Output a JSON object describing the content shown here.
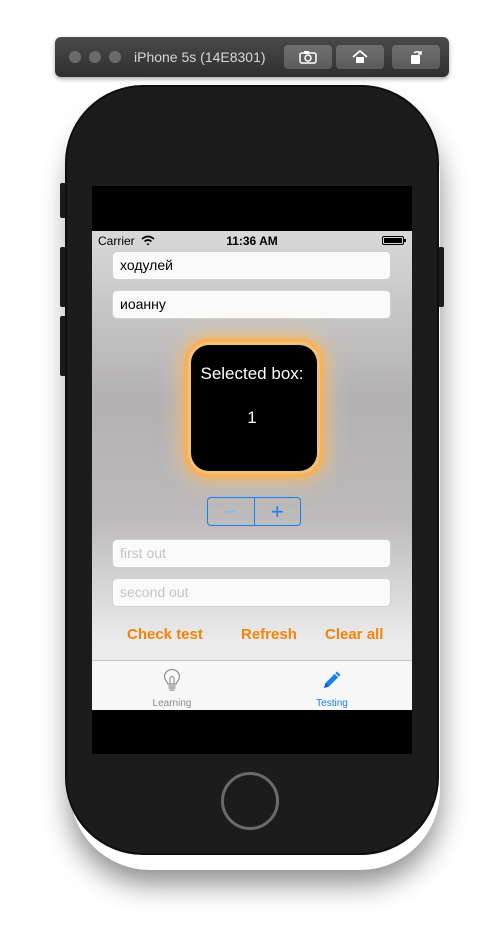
{
  "simulator": {
    "title": "iPhone 5s (14E8301)",
    "buttons": [
      "screenshot-icon",
      "home-icon",
      "rotate-icon"
    ]
  },
  "status_bar": {
    "carrier": "Carrier",
    "time": "11:36 AM"
  },
  "fields": {
    "field1_value": "ходулей",
    "field2_value": "иоанну",
    "first_out_placeholder": "first out",
    "second_out_placeholder": "second out"
  },
  "selected_box": {
    "label": "Selected box:",
    "value": "1"
  },
  "stepper": {
    "minus": "−",
    "plus": "+"
  },
  "actions": {
    "check_test": "Check test",
    "refresh": "Refresh",
    "clear_all": "Clear all"
  },
  "tab_bar": {
    "tabs": [
      {
        "label": "Learning",
        "icon": "lightbulb-icon",
        "selected": false
      },
      {
        "label": "Testing",
        "icon": "pencil-icon",
        "selected": true
      }
    ]
  },
  "colors": {
    "accent_orange": "#f5820b",
    "tint_blue": "#1a7ff0",
    "glow": "#f8b050"
  }
}
